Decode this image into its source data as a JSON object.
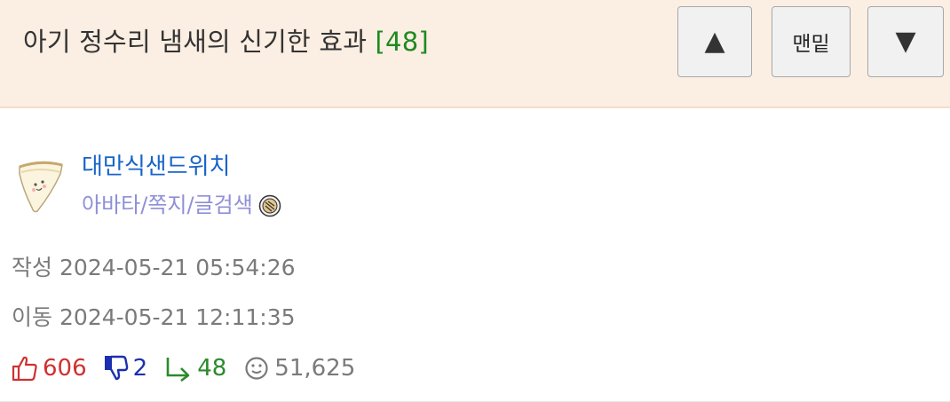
{
  "header": {
    "title": "아기 정수리 냄새의 신기한 효과",
    "comment_count": "[48]",
    "buttons": {
      "up_icon": "triangle-up-icon",
      "bottom_label": "맨밑",
      "down_icon": "triangle-down-icon"
    }
  },
  "author": {
    "name": "대만식샌드위치",
    "links": "아바타/쪽지/글검색",
    "avatar_icon": "sandwich-avatar-icon",
    "badge_icon": "level-badge-icon"
  },
  "meta": {
    "written_label": "작성",
    "written_time": "2024-05-21 05:54:26",
    "moved_label": "이동",
    "moved_time": "2024-05-21 12:11:35"
  },
  "stats": {
    "likes": "606",
    "dislikes": "2",
    "replies": "48",
    "views": "51,625"
  },
  "colors": {
    "header_bg": "#fbeee3",
    "author_name": "#1864c8",
    "author_links": "#8f8fd8",
    "comment_count": "#1e8a1e",
    "likes": "#d03030",
    "dislikes": "#1c2fae",
    "replies": "#2b8a2b",
    "meta": "#7a7a7a"
  }
}
